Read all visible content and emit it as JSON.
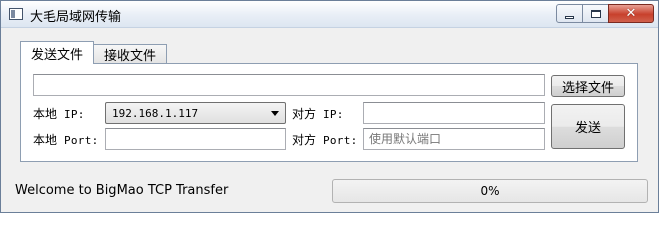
{
  "window": {
    "title": "大毛局域网传输",
    "icons": {
      "app": "window-app-icon",
      "minimize": "minimize-icon",
      "maximize": "maximize-icon",
      "close": "close-icon"
    },
    "close_glyph": "✕"
  },
  "tabs": [
    {
      "label": "发送文件",
      "selected": true
    },
    {
      "label": "接收文件",
      "selected": false
    }
  ],
  "send": {
    "file_path": {
      "value": "",
      "placeholder": ""
    },
    "choose_file_button": "选择文件",
    "local_ip": {
      "label_cjk": "本地",
      "label_suffix": " IP:",
      "selected": "192.168.1.117"
    },
    "remote_ip": {
      "label_cjk": "对方",
      "label_suffix": " IP:",
      "value": "",
      "placeholder": ""
    },
    "local_port": {
      "label_cjk": "本地",
      "label_suffix": " Port:",
      "value": "",
      "placeholder": ""
    },
    "remote_port": {
      "label_cjk": "对方",
      "label_suffix": " Port:",
      "value": "",
      "placeholder": "使用默认端口"
    },
    "send_button": "发送"
  },
  "status": {
    "message": "Welcome to BigMao TCP Transfer",
    "progress_percent": 0,
    "progress_label": "0%"
  }
}
